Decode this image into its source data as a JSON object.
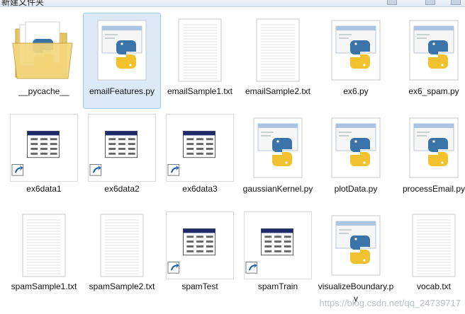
{
  "window": {
    "title": "新建文件夹"
  },
  "files": [
    {
      "name": "__pycache__",
      "kind": "folder"
    },
    {
      "name": "emailFeatures.py",
      "kind": "py",
      "selected": true
    },
    {
      "name": "emailSample1.txt",
      "kind": "txt"
    },
    {
      "name": "emailSample2.txt",
      "kind": "txt"
    },
    {
      "name": "ex6.py",
      "kind": "py"
    },
    {
      "name": "ex6_spam.py",
      "kind": "py"
    },
    {
      "name": "ex6data1",
      "kind": "shortcut"
    },
    {
      "name": "ex6data2",
      "kind": "shortcut"
    },
    {
      "name": "ex6data3",
      "kind": "shortcut"
    },
    {
      "name": "gaussianKernel.py",
      "kind": "py"
    },
    {
      "name": "plotData.py",
      "kind": "py"
    },
    {
      "name": "processEmail.py",
      "kind": "py"
    },
    {
      "name": "spamSample1.txt",
      "kind": "txt"
    },
    {
      "name": "spamSample2.txt",
      "kind": "txt"
    },
    {
      "name": "spamTest",
      "kind": "shortcut"
    },
    {
      "name": "spamTrain",
      "kind": "shortcut"
    },
    {
      "name": "visualizeBoundary.py",
      "kind": "py"
    },
    {
      "name": "vocab.txt",
      "kind": "txt"
    }
  ],
  "watermark": "https://blog.csdn.net/qq_24739717"
}
